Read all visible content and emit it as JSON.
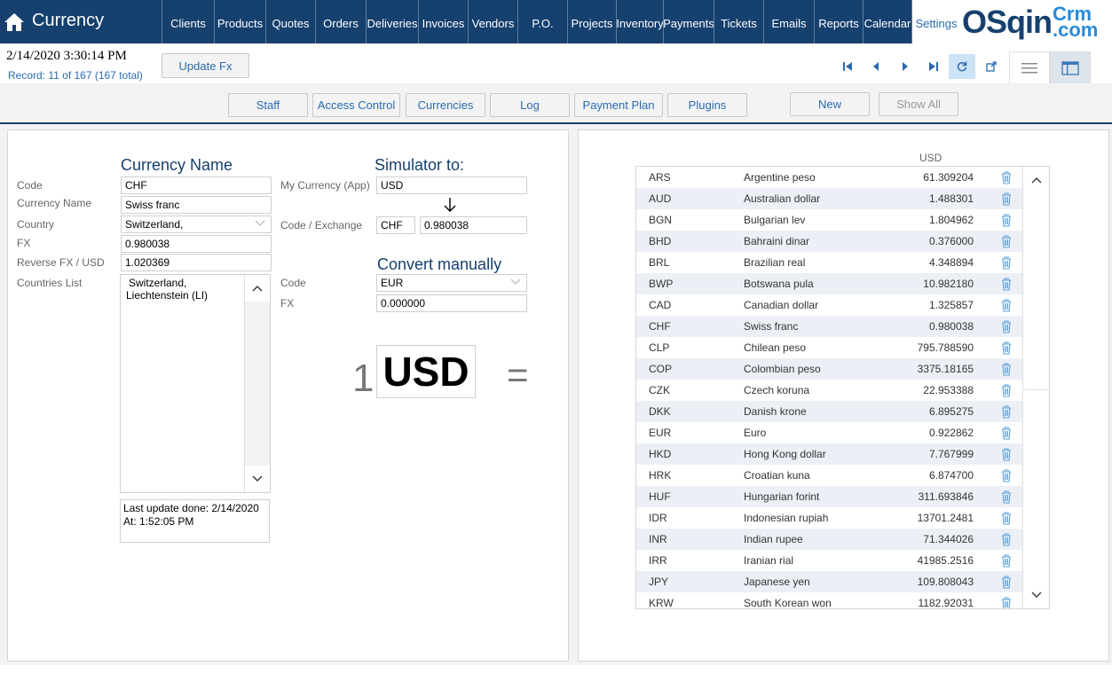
{
  "app": {
    "title": "Currency"
  },
  "nav": [
    {
      "label": "Clients",
      "w": 59
    },
    {
      "label": "Products",
      "w": 58
    },
    {
      "label": "Quotes",
      "w": 56
    },
    {
      "label": "Orders",
      "w": 57
    },
    {
      "label": "Deliveries",
      "w": 59
    },
    {
      "label": "Invoices",
      "w": 56
    },
    {
      "label": "Vendors",
      "w": 56
    },
    {
      "label": "P.O.",
      "w": 56
    },
    {
      "label": "Projects",
      "w": 55
    },
    {
      "label": "Inventory",
      "w": 53
    },
    {
      "label": "Payments",
      "w": 57
    },
    {
      "label": "Tickets",
      "w": 56
    },
    {
      "label": "Emails",
      "w": 57
    },
    {
      "label": "Reports",
      "w": 55
    },
    {
      "label": "Calendar",
      "w": 55
    },
    {
      "label": "Settings",
      "w": 55,
      "active": true
    }
  ],
  "logo": {
    "main": "OSqin",
    "top": "Crm",
    "bottom": ".com"
  },
  "recbar": {
    "clock": "2/14/2020 3:30:14 PM",
    "record": "Record:  11 of 167 (167 total)",
    "update_fx": "Update Fx"
  },
  "subbar": {
    "staff": "Staff",
    "access": "Access Control",
    "currencies": "Currencies",
    "log": "Log",
    "payment_plan": "Payment Plan",
    "plugins": "Plugins",
    "new": "New",
    "show_all": "Show All"
  },
  "form": {
    "currency_name_heading": "Currency Name",
    "code_label": "Code",
    "code_value": "CHF",
    "name_label": "Currency Name",
    "name_value": "Swiss franc",
    "country_label": "Country",
    "country_value": "Switzerland,",
    "fx_label": "FX",
    "fx_value": "0.980038",
    "rev_label": "Reverse FX / USD",
    "rev_value": "1.020369",
    "countries_label": "Countries List",
    "countries_line1": "Switzerland,",
    "countries_line2": "Liechtenstein (LI)",
    "last_update_line1": "Last update done: 2/14/2020",
    "last_update_line2": "At: 1:52:05 PM"
  },
  "simulator": {
    "heading": "Simulator to:",
    "my_currency_label": "My  Currency (App)",
    "my_currency_value": "USD",
    "code_exchange_label": "Code / Exchange",
    "code_value": "CHF",
    "exchange_value": "0.980038",
    "convert_heading": "Convert manually",
    "conv_code_label": "Code",
    "conv_code_value": "EUR",
    "conv_fx_label": "FX",
    "conv_fx_value": "0.000000",
    "one": "1",
    "big_code": "USD",
    "equals": "="
  },
  "table": {
    "header": "USD",
    "rows": [
      {
        "code": "ARS",
        "name": "Argentine peso",
        "rate": "61.309204"
      },
      {
        "code": "AUD",
        "name": "Australian dollar",
        "rate": "1.488301"
      },
      {
        "code": "BGN",
        "name": "Bulgarian lev",
        "rate": "1.804962"
      },
      {
        "code": "BHD",
        "name": "Bahraini dinar",
        "rate": "0.376000"
      },
      {
        "code": "BRL",
        "name": "Brazilian real",
        "rate": "4.348894"
      },
      {
        "code": "BWP",
        "name": "Botswana pula",
        "rate": "10.982180"
      },
      {
        "code": "CAD",
        "name": "Canadian dollar",
        "rate": "1.325857"
      },
      {
        "code": "CHF",
        "name": "Swiss franc",
        "rate": "0.980038"
      },
      {
        "code": "CLP",
        "name": "Chilean peso",
        "rate": "795.788590"
      },
      {
        "code": "COP",
        "name": "Colombian peso",
        "rate": "3375.18165"
      },
      {
        "code": "CZK",
        "name": "Czech koruna",
        "rate": "22.953388"
      },
      {
        "code": "DKK",
        "name": "Danish krone",
        "rate": "6.895275"
      },
      {
        "code": "EUR",
        "name": "Euro",
        "rate": "0.922862"
      },
      {
        "code": "HKD",
        "name": "Hong Kong dollar",
        "rate": "7.767999"
      },
      {
        "code": "HRK",
        "name": "Croatian kuna",
        "rate": "6.874700"
      },
      {
        "code": "HUF",
        "name": "Hungarian forint",
        "rate": "311.693846"
      },
      {
        "code": "IDR",
        "name": "Indonesian rupiah",
        "rate": "13701.2481"
      },
      {
        "code": "INR",
        "name": "Indian rupee",
        "rate": "71.344026"
      },
      {
        "code": "IRR",
        "name": "Iranian rial",
        "rate": "41985.2516"
      },
      {
        "code": "JPY",
        "name": "Japanese yen",
        "rate": "109.808043"
      },
      {
        "code": "KRW",
        "name": "South Korean won",
        "rate": "1182.92031"
      }
    ]
  },
  "icons": {
    "home": "home-icon",
    "first": "first-record-icon",
    "prev": "previous-record-icon",
    "next": "next-record-icon",
    "last": "last-record-icon",
    "refresh": "refresh-icon",
    "popout": "open-external-icon",
    "list_view": "list-view-icon",
    "form_view": "form-view-icon",
    "trash": "trash-icon"
  },
  "colors": {
    "nav_bg": "#16406e",
    "accent": "#2a6bb0",
    "row_alt": "#ecf0f6"
  }
}
